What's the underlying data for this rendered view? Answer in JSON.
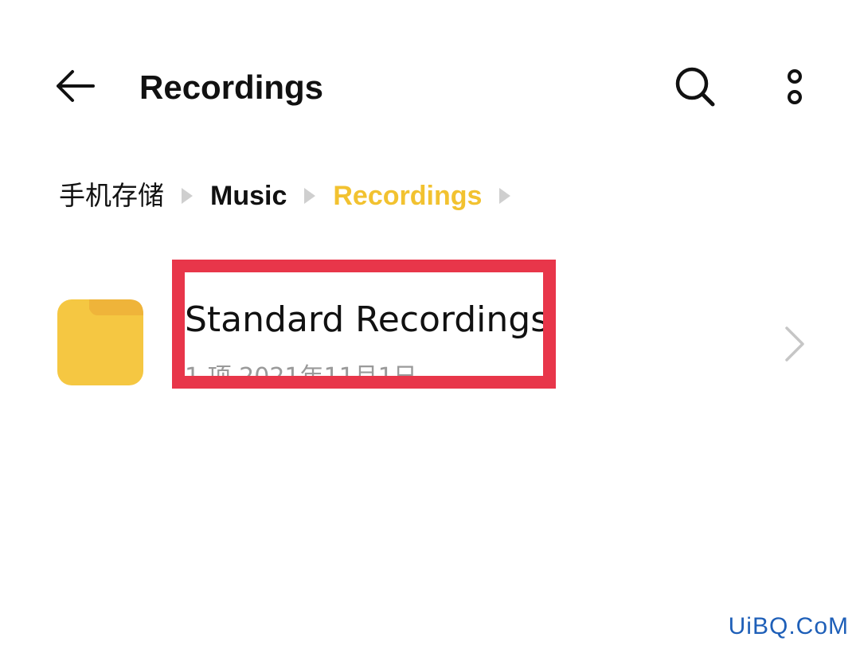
{
  "app_bar": {
    "title": "Recordings",
    "back_icon": "arrow-left-icon",
    "search_icon": "search-icon",
    "more_icon": "more-vertical-icon"
  },
  "breadcrumb": {
    "items": [
      {
        "label": "手机存储",
        "current": false
      },
      {
        "label": "Music",
        "current": false
      },
      {
        "label": "Recordings",
        "current": true
      }
    ],
    "separator_icon": "triangle-right-icon",
    "current_color": "#f2c230"
  },
  "list": {
    "items": [
      {
        "name": "Standard Recordings",
        "meta": "1 项    2021年11月1日",
        "icon": "folder-icon",
        "folder_color": "#f5c742",
        "chevron_icon": "chevron-right-icon"
      }
    ]
  },
  "annotation": {
    "highlight_color": "#e8364a"
  },
  "watermark": {
    "text": "UiBQ.CoM"
  }
}
